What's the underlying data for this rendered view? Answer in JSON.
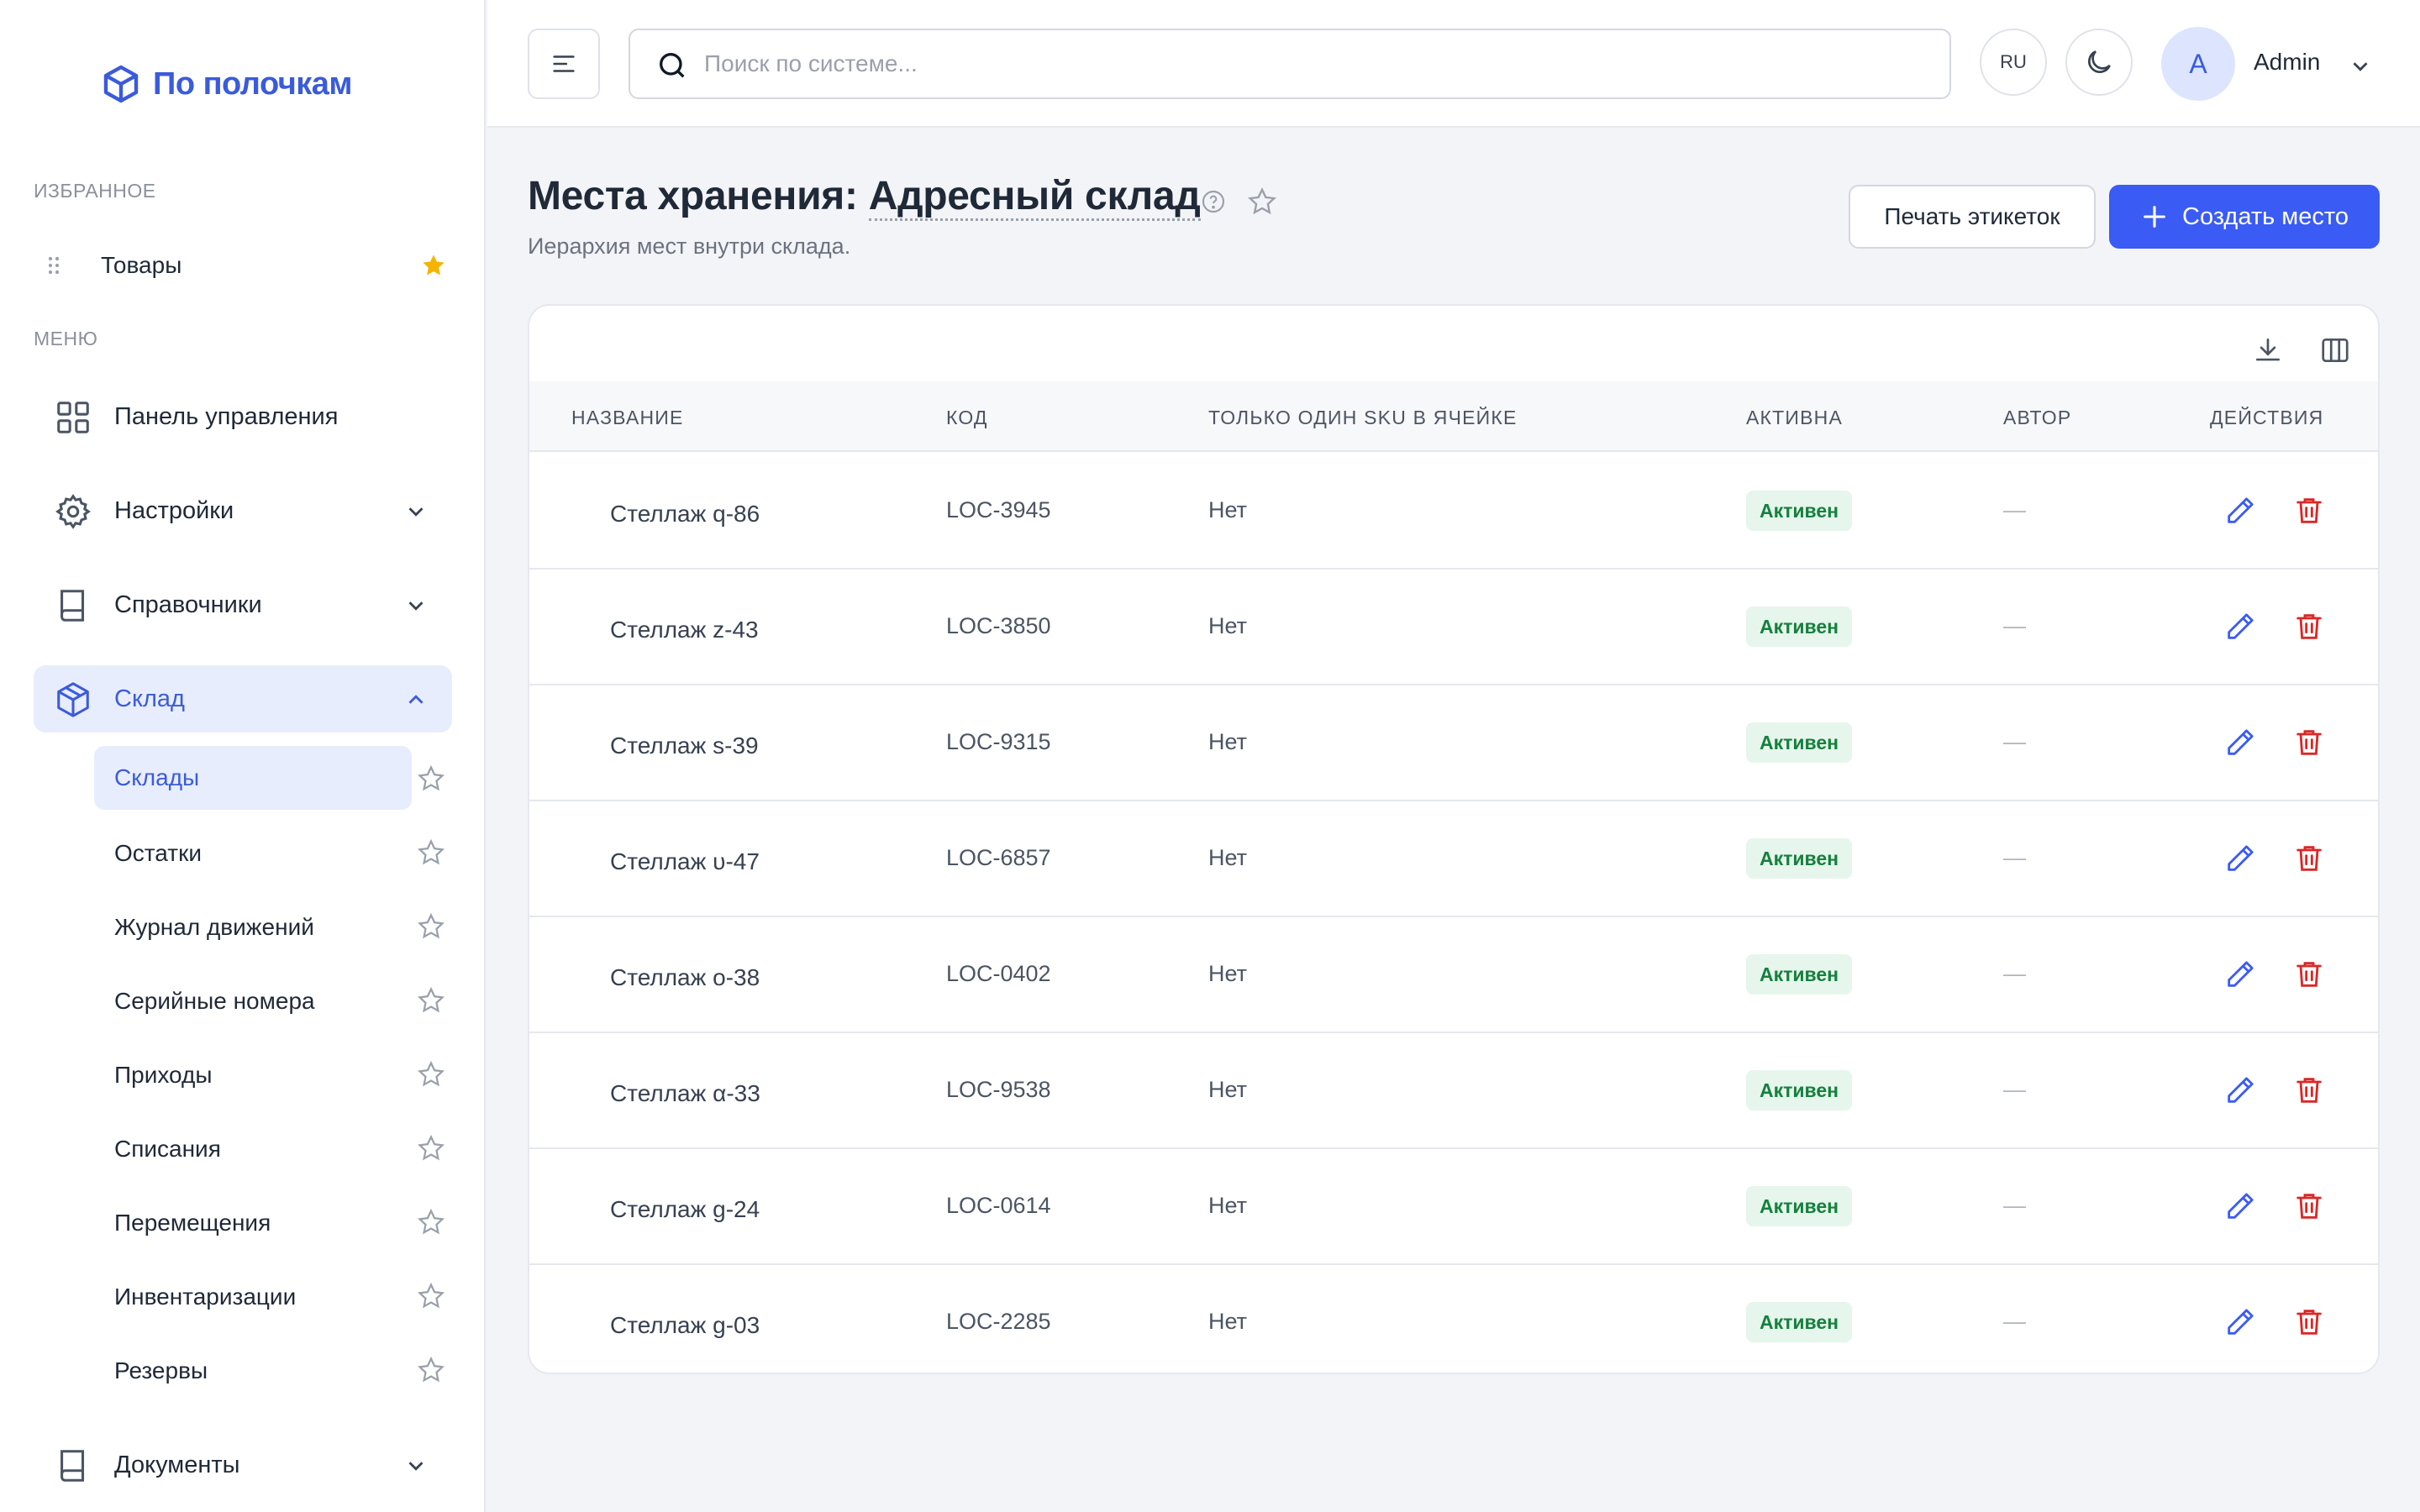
{
  "app": {
    "logo_text": "По полочкам"
  },
  "sidebar": {
    "favorites_title": "ИЗБРАННОЕ",
    "favorites": [
      {
        "label": "Товары"
      }
    ],
    "menu_title": "МЕНЮ",
    "nav": [
      {
        "label": "Панель управления",
        "icon": "grid-icon"
      },
      {
        "label": "Настройки",
        "icon": "gear-icon"
      },
      {
        "label": "Справочники",
        "icon": "book-icon"
      },
      {
        "label": "Склад",
        "icon": "box-icon",
        "expanded": true
      },
      {
        "label": "Документы",
        "icon": "book-icon"
      }
    ],
    "warehouse_sub": [
      {
        "label": "Склады",
        "active": true
      },
      {
        "label": "Остатки"
      },
      {
        "label": "Журнал движений"
      },
      {
        "label": "Серийные номера"
      },
      {
        "label": "Приходы"
      },
      {
        "label": "Списания"
      },
      {
        "label": "Перемещения"
      },
      {
        "label": "Инвентаризации"
      },
      {
        "label": "Резервы"
      }
    ]
  },
  "header": {
    "search_placeholder": "Поиск по системе...",
    "lang": "RU",
    "avatar_letter": "A",
    "user_name": "Admin"
  },
  "page": {
    "title_prefix": "Места хранения: ",
    "title_warehouse": "Адресный склад",
    "subtitle": "Иерархия мест внутри склада.",
    "print_label": "Печать этикеток",
    "create_label": "Создать место"
  },
  "table": {
    "columns": [
      "НАЗВАНИЕ",
      "КОД",
      "ТОЛЬКО ОДИН SKU В ЯЧЕЙКЕ",
      "АКТИВНА",
      "АВТОР",
      "ДЕЙСТВИЯ"
    ],
    "rows": [
      {
        "name": "Стеллаж q-86",
        "code": "LOC-3945",
        "single_sku": "Нет",
        "status": "Активен",
        "author": "—"
      },
      {
        "name": "Стеллаж z-43",
        "code": "LOC-3850",
        "single_sku": "Нет",
        "status": "Активен",
        "author": "—"
      },
      {
        "name": "Стеллаж s-39",
        "code": "LOC-9315",
        "single_sku": "Нет",
        "status": "Активен",
        "author": "—"
      },
      {
        "name": "Стеллаж υ-47",
        "code": "LOC-6857",
        "single_sku": "Нет",
        "status": "Активен",
        "author": "—"
      },
      {
        "name": "Стеллаж o-38",
        "code": "LOC-0402",
        "single_sku": "Нет",
        "status": "Активен",
        "author": "—"
      },
      {
        "name": "Стеллаж α-33",
        "code": "LOC-9538",
        "single_sku": "Нет",
        "status": "Активен",
        "author": "—"
      },
      {
        "name": "Стеллаж g-24",
        "code": "LOC-0614",
        "single_sku": "Нет",
        "status": "Активен",
        "author": "—"
      },
      {
        "name": "Стеллаж g-03",
        "code": "LOC-2285",
        "single_sku": "Нет",
        "status": "Активен",
        "author": "—"
      }
    ]
  },
  "colors": {
    "accent": "#3b5bf5",
    "active_bg": "#e8edfd",
    "status_green": "#15803d",
    "delete_red": "#dc2626",
    "fav_star": "#f4b400"
  }
}
